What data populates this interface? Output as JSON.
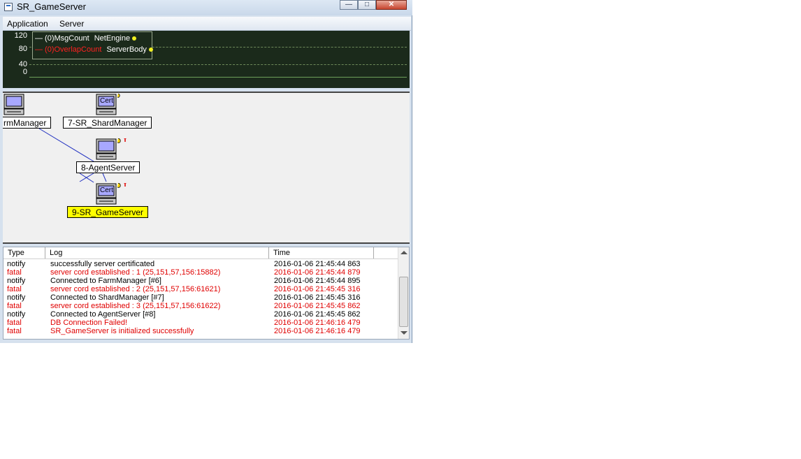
{
  "window": {
    "title": "SR_GameServer",
    "minimize_label": "—",
    "maximize_label": "□",
    "close_label": "✕"
  },
  "menu": {
    "items": [
      "Application",
      "Server"
    ]
  },
  "graph": {
    "y_ticks": [
      "120",
      "80",
      "40",
      "0"
    ],
    "legend": [
      {
        "prefix": "— (0)MsgCount",
        "target": "NetEngine",
        "color": "#ffffff"
      },
      {
        "prefix": "— (0)OverlapCount",
        "target": "ServerBody",
        "color": "#ff2020"
      }
    ]
  },
  "diagram": {
    "nodes": [
      {
        "label": "rmManager",
        "icon": "computer-icon",
        "cert": false
      },
      {
        "label": "7-SR_ShardManager",
        "icon": "computer-icon",
        "cert": true,
        "cert_label": "Cert"
      },
      {
        "label": "8-AgentServer",
        "icon": "computer-icon",
        "cert": false
      },
      {
        "label": "9-SR_GameServer",
        "icon": "computer-icon",
        "cert": true,
        "cert_label": "Cert",
        "selected": true
      }
    ]
  },
  "log": {
    "columns": [
      "Type",
      "Log",
      "Time"
    ],
    "rows": [
      {
        "type": "notify",
        "log": "successfully server certificated",
        "time": "2016-01-06 21:45:44 863"
      },
      {
        "type": "fatal",
        "log": "server cord established : 1 (25,151,57,156:15882)",
        "time": "2016-01-06 21:45:44 879"
      },
      {
        "type": "notify",
        "log": "Connected to FarmManager [#6]",
        "time": "2016-01-06 21:45:44 895"
      },
      {
        "type": "fatal",
        "log": "server cord established : 2 (25,151,57,156:61621)",
        "time": "2016-01-06 21:45:45 316"
      },
      {
        "type": "notify",
        "log": "Connected to ShardManager [#7]",
        "time": "2016-01-06 21:45:45 316"
      },
      {
        "type": "fatal",
        "log": "server cord established : 3 (25,151,57,156:61622)",
        "time": "2016-01-06 21:45:45 862"
      },
      {
        "type": "notify",
        "log": "Connected to AgentServer [#8]",
        "time": "2016-01-06 21:45:45 862"
      },
      {
        "type": "fatal",
        "log": "DB Connection Failed!",
        "time": "2016-01-06 21:46:16 479"
      },
      {
        "type": "fatal",
        "log": "SR_GameServer is initialized successfully",
        "time": "2016-01-06 21:46:16 479"
      }
    ]
  },
  "colors": {
    "graph_bg": "#1b2a1b",
    "fatal": "#e00000",
    "selected_node": "#ffff00",
    "connector": "#2030c0"
  }
}
